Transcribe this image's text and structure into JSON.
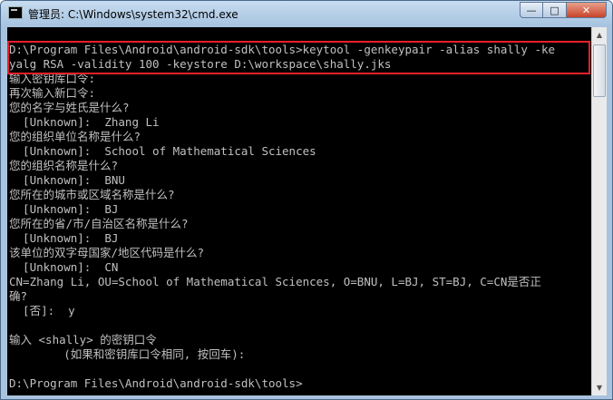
{
  "window": {
    "title": "管理员: C:\\Windows\\system32\\cmd.exe",
    "icon": "console-icon",
    "buttons": {
      "minimize_icon": "—",
      "maximize_icon": "□",
      "close_icon": "✕"
    }
  },
  "console": {
    "lines": [
      "D:\\Program Files\\Android\\android-sdk\\tools>keytool -genkeypair -alias shally -ke",
      "yalg RSA -validity 100 -keystore D:\\workspace\\shally.jks",
      "输入密钥库口令:",
      "再次输入新口令:",
      "您的名字与姓氏是什么?",
      "  [Unknown]:  Zhang Li",
      "您的组织单位名称是什么?",
      "  [Unknown]:  School of Mathematical Sciences",
      "您的组织名称是什么?",
      "  [Unknown]:  BNU",
      "您所在的城市或区域名称是什么?",
      "  [Unknown]:  BJ",
      "您所在的省/市/自治区名称是什么?",
      "  [Unknown]:  BJ",
      "该单位的双字母国家/地区代码是什么?",
      "  [Unknown]:  CN",
      "CN=Zhang Li, OU=School of Mathematical Sciences, O=BNU, L=BJ, ST=BJ, C=CN是否正",
      "确?",
      "  [否]:  y",
      "",
      "输入 <shally> 的密钥口令",
      "        (如果和密钥库口令相同, 按回车):",
      "",
      "D:\\Program Files\\Android\\android-sdk\\tools>"
    ]
  },
  "scrollbar": {
    "up_icon": "▲",
    "down_icon": "▼"
  },
  "colors": {
    "console_background": "#000000",
    "console_text": "#c0c0c0",
    "highlight_border": "#e8202a",
    "titlebar": "#b5cde6"
  }
}
